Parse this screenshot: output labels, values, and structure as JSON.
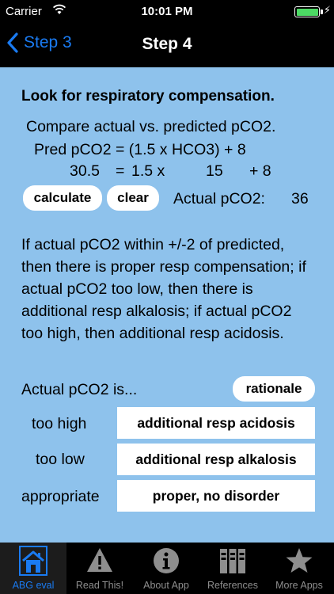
{
  "status_bar": {
    "carrier": "Carrier",
    "time": "10:01 PM",
    "charging_glyph": "⚡",
    "battery_color": "#4cd964"
  },
  "nav": {
    "back_label": "Step 3",
    "title": "Step 4"
  },
  "content": {
    "heading": "Look for respiratory compensation.",
    "compare": "Compare actual vs. predicted pCO2.",
    "formula": "Pred pCO2 = (1.5 x HCO3) + 8",
    "formula_values": {
      "pred": "30.5",
      "eq": "=",
      "factor": "1.5 x",
      "hco3": "15",
      "plus": "+ 8"
    },
    "calculate_label": "calculate",
    "clear_label": "clear",
    "actual_label": "Actual pCO2:",
    "actual_value": "36",
    "explanation": "If actual pCO2 within +/-2 of predicted, then there is proper resp compensation; if actual pCO2 too low, then there is additional resp alkalosis; if actual pCO2 too high, then additional resp acidosis.",
    "actual_is": "Actual pCO2 is...",
    "rationale_label": "rationale",
    "rows": [
      {
        "label": "too high",
        "result": "additional resp acidosis"
      },
      {
        "label": "too low",
        "result": "additional resp alkalosis"
      },
      {
        "label": "appropriate",
        "result": "proper, no disorder"
      }
    ],
    "background_color": "#8ec2ec"
  },
  "tab_bar": {
    "active_color": "#1a7bf2",
    "tabs": [
      {
        "label": "ABG eval",
        "icon": "house-icon",
        "active": true
      },
      {
        "label": "Read This!",
        "icon": "warning-icon",
        "active": false
      },
      {
        "label": "About App",
        "icon": "info-icon",
        "active": false
      },
      {
        "label": "References",
        "icon": "books-icon",
        "active": false
      },
      {
        "label": "More Apps",
        "icon": "star-icon",
        "active": false
      }
    ]
  }
}
